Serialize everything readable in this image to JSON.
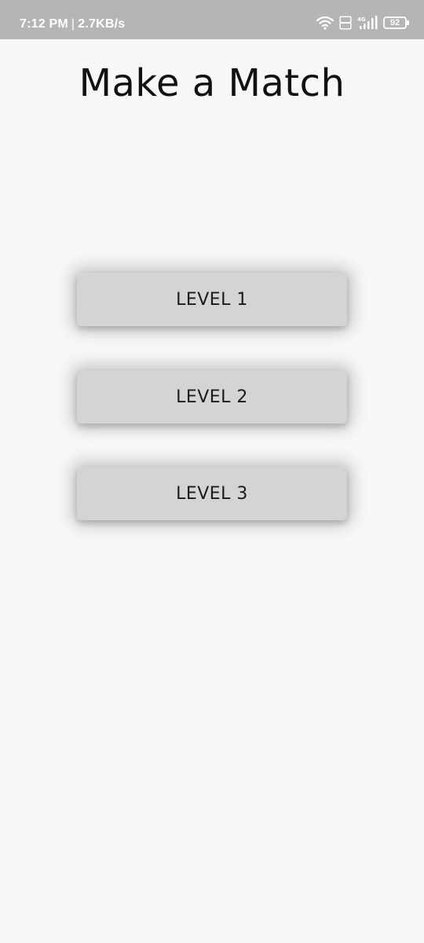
{
  "status_bar": {
    "time": "7:12 PM",
    "separator": "|",
    "network_speed": "2.7KB/s",
    "network_type": "4G",
    "volte_label": "Vo LTE",
    "battery_level": "92",
    "icons": [
      "wifi-icon",
      "volte-icon",
      "signal-icon",
      "battery-icon"
    ]
  },
  "app": {
    "title": "Make a Match"
  },
  "levels": [
    {
      "label": "LEVEL 1"
    },
    {
      "label": "LEVEL 2"
    },
    {
      "label": "LEVEL 3"
    }
  ],
  "colors": {
    "status_bar_bg": "#b5b5b5",
    "page_bg": "#f8f8f8",
    "button_bg": "#d4d4d4",
    "text": "#111111"
  }
}
